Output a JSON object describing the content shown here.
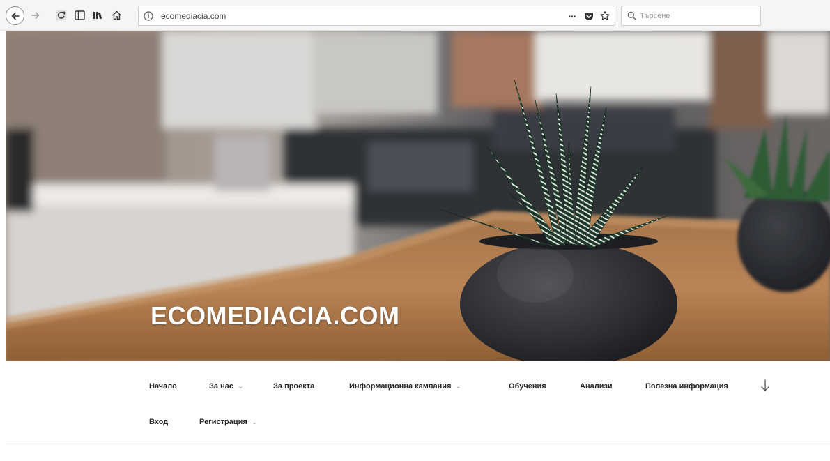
{
  "browser": {
    "url": "ecomediacia.com",
    "search_placeholder": "Търсене",
    "page_actions_label": "···"
  },
  "hero": {
    "site_title": "ECOMEDIACIA.COM"
  },
  "nav": {
    "row1": [
      {
        "label": "Начало",
        "has_submenu": false
      },
      {
        "label": "За нас",
        "has_submenu": true
      },
      {
        "label": "За проекта",
        "has_submenu": false
      },
      {
        "label": "Информационна кампания",
        "has_submenu": true
      },
      {
        "label": "Обучения",
        "has_submenu": false
      },
      {
        "label": "Анализи",
        "has_submenu": false
      },
      {
        "label": "Полезна информация",
        "has_submenu": false
      }
    ],
    "row2": [
      {
        "label": "Вход",
        "has_submenu": false
      },
      {
        "label": "Регистрация",
        "has_submenu": true
      }
    ],
    "caret": "⌄"
  }
}
